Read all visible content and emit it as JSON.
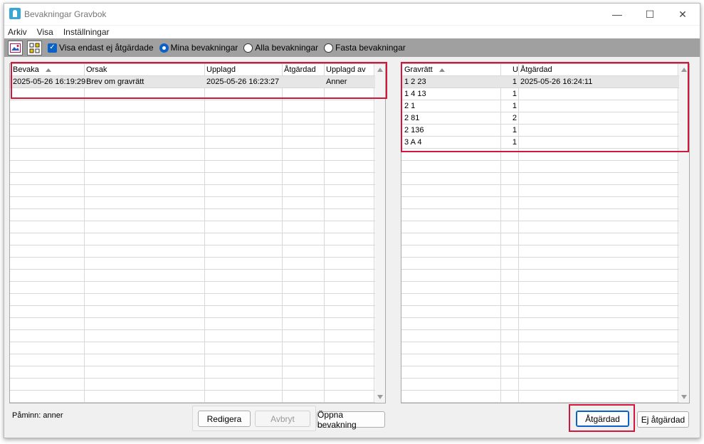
{
  "window": {
    "title": "Bevakningar Gravbok"
  },
  "menu": [
    "Arkiv",
    "Visa",
    "Inställningar"
  ],
  "toolbar": {
    "show_unhandled": "Visa endast ej åtgärdade",
    "radio_mine": "Mina bevakningar",
    "radio_all": "Alla bevakningar",
    "radio_fixed": "Fasta bevakningar",
    "selected_radio": "Mina bevakningar"
  },
  "left_table": {
    "headers": [
      "Bevaka",
      "Orsak",
      "Upplagd",
      "Åtgärdad",
      "Upplagd av"
    ],
    "rows": [
      [
        "2025-05-26 16:19:29",
        "Brev om gravrätt",
        "2025-05-26 16:23:27",
        "",
        "Anner"
      ]
    ]
  },
  "right_table": {
    "headers": [
      "Gravrätt",
      "U",
      "Åtgärdad"
    ],
    "rows": [
      [
        "1 2  23",
        "1",
        "2025-05-26 16:24:11"
      ],
      [
        "1 4  13",
        "1",
        ""
      ],
      [
        "2   1",
        "1",
        ""
      ],
      [
        "2   81",
        "2",
        ""
      ],
      [
        "2   136",
        "1",
        ""
      ],
      [
        "3 A  4",
        "1",
        ""
      ]
    ]
  },
  "status": {
    "reminder": "Påminn: anner"
  },
  "buttons": {
    "edit": "Redigera",
    "cancel": "Avbryt",
    "open": "Öppna bevakning",
    "handled": "Åtgärdad",
    "not_handled": "Ej åtgärdad"
  },
  "colors": {
    "accent": "#0b62c4",
    "highlight": "#d2163c",
    "toolbar_bg": "#a0a0a0"
  }
}
